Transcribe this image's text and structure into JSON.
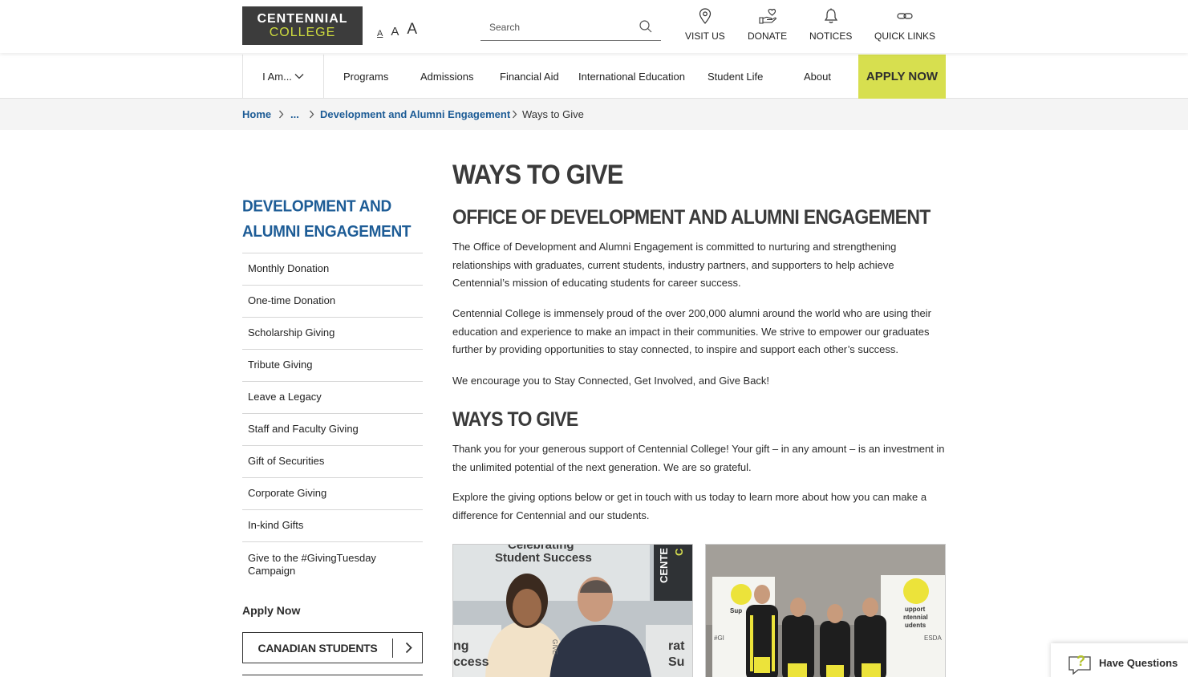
{
  "header": {
    "logo_line1": "CENTENNIAL",
    "logo_line2": "COLLEGE",
    "font_sizes": [
      "A",
      "A",
      "A"
    ],
    "search_placeholder": "Search",
    "links": [
      {
        "label": "VISIT US",
        "icon": "map-pin-icon"
      },
      {
        "label": "DONATE",
        "icon": "hand-heart-icon"
      },
      {
        "label": "NOTICES",
        "icon": "bell-icon"
      },
      {
        "label": "QUICK LINKS",
        "icon": "link-icon"
      }
    ]
  },
  "nav": {
    "iam": "I Am...",
    "items": [
      "Programs",
      "Admissions",
      "Financial Aid",
      "International Education",
      "Student Life",
      "About"
    ],
    "apply": "APPLY NOW"
  },
  "breadcrumb": {
    "home": "Home",
    "ellipsis": "...",
    "parent": "Development and Alumni Engagement",
    "current": "Ways to Give"
  },
  "sidebar": {
    "title": "DEVELOPMENT AND ALUMNI ENGAGEMENT",
    "items": [
      "Monthly Donation",
      "One-time Donation",
      "Scholarship Giving",
      "Tribute Giving",
      "Leave a Legacy",
      "Staff and Faculty Giving",
      "Gift of Securities",
      "Corporate Giving",
      "In-kind Gifts",
      "Give to the #GivingTuesday Campaign"
    ],
    "apply_heading": "Apply Now",
    "cta_canadian": "CANADIAN STUDENTS"
  },
  "main": {
    "title": "WAYS TO GIVE",
    "subtitle": "OFFICE OF DEVELOPMENT AND ALUMNI ENGAGEMENT",
    "p1": "The Office of Development and Alumni Engagement is committed to nurturing and strengthening relationships with graduates, current students, industry partners, and supporters to help achieve Centennial’s mission of educating students for career success.",
    "p2": "Centennial College is immensely proud of the over 200,000 alumni around the world who are using their education and experience to make an impact in their communities. We strive to empower our graduates further by providing opportunities to stay connected, to inspire and support each other’s success.",
    "p3": "We encourage you to Stay Connected, Get Involved, and Give Back!",
    "h2b": "WAYS TO GIVE",
    "p4": "Thank you for your generous support of Centennial College! Your gift – in any amount – is an investment in the unlimited potential of the next generation. We are so grateful.",
    "p5": "Explore the giving options below or get in touch with us today to learn more about how you can make a difference for Centennial and our students.",
    "photo1_banner_top": "Celebrating",
    "photo1_banner": "Student Success",
    "photo1_side": "CENTE",
    "photo1_side2": "C",
    "photo1_left1": "ng",
    "photo1_left2": "ccess",
    "photo1_right1": "rat",
    "photo1_right2": "Su",
    "photo1_sign": "GIVE",
    "photo2_sign1": "Sup",
    "photo2_sign2a": "upport",
    "photo2_sign2b": "ntennial",
    "photo2_sign2c": "udents",
    "photo2_tag1": "#GI",
    "photo2_tag2": "ESDA"
  },
  "help": {
    "label": "Have Questions"
  },
  "colors": {
    "accent": "#d7df4f",
    "link": "#1d5c96",
    "logo_bg": "#3c3c3c"
  }
}
